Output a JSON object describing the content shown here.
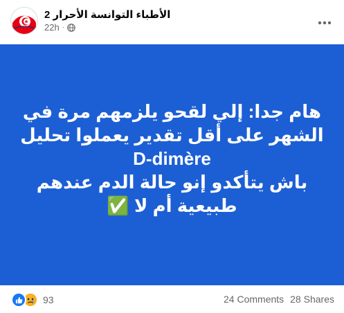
{
  "post": {
    "page_name": "الأطباء التوانسة الأحرار 2",
    "time": "22h",
    "separator": "·",
    "privacy_icon": "globe-icon",
    "more_icon": "more-dots-icon"
  },
  "content": {
    "background_color": "#1c5fd4",
    "lines": [
      "هام جدا: إلي لقحو يلزمهم مرة في",
      "الشهر على أقل تقدير يعملوا تحليل",
      "D-dimère",
      "باش يتأكدو إنو حالة الدم عندهم",
      "طبيعية أم لا ✅"
    ]
  },
  "footer": {
    "reaction_icons": [
      "like-icon",
      "sad-icon"
    ],
    "reaction_count": "93",
    "comments": "24 Comments",
    "shares": "28 Shares"
  }
}
